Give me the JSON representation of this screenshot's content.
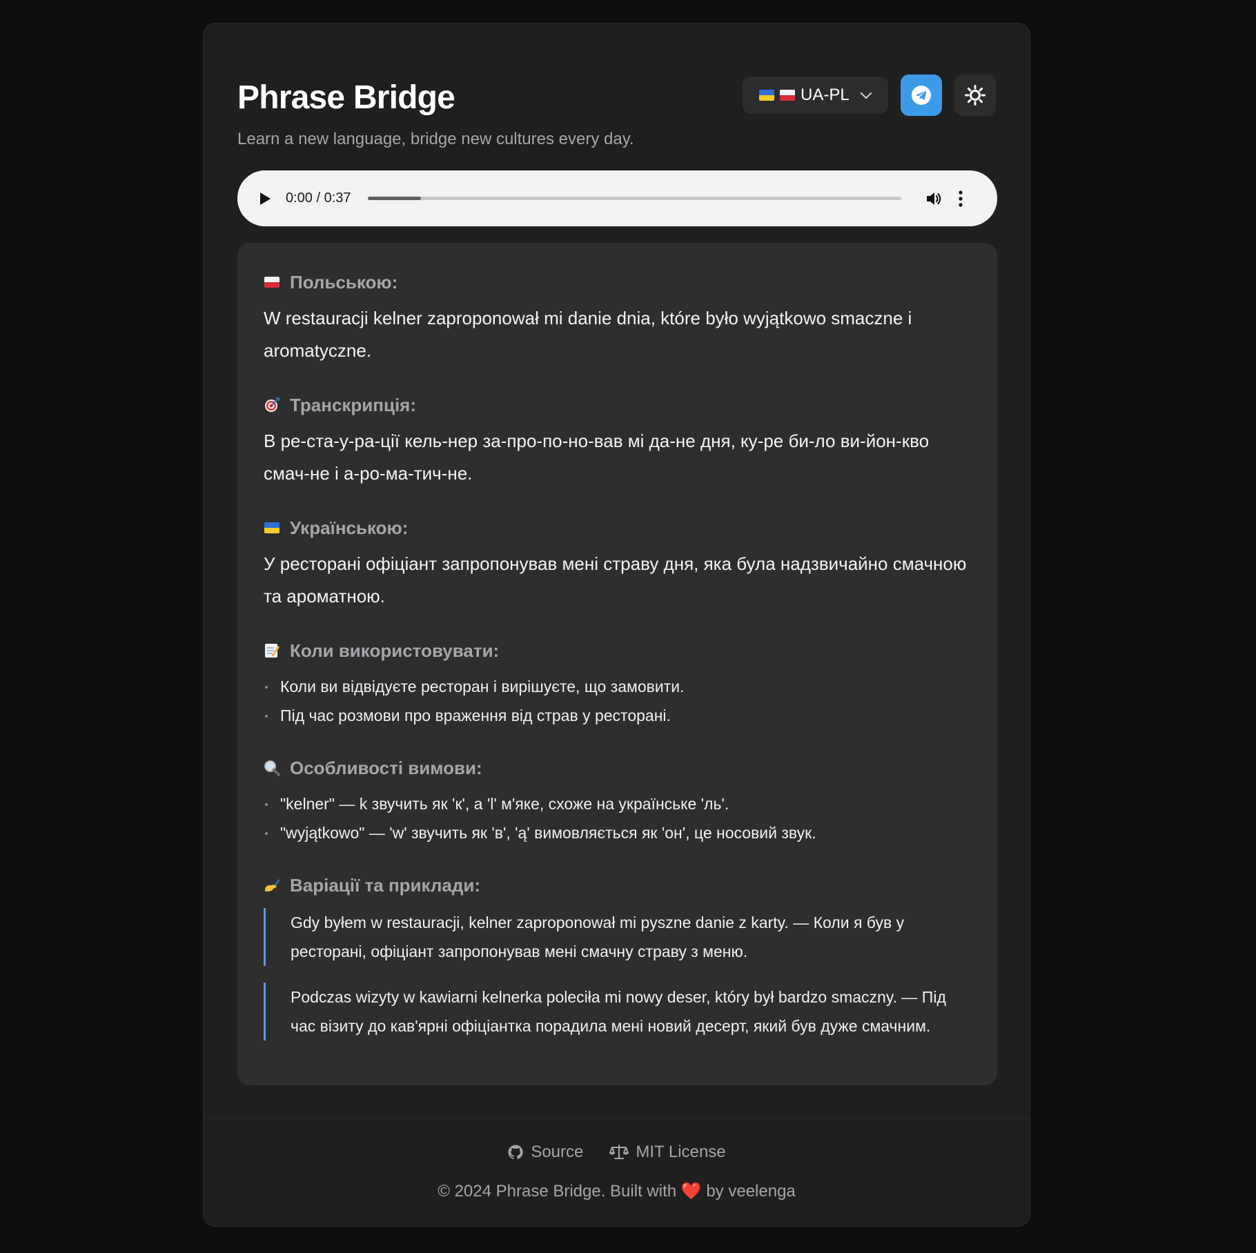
{
  "header": {
    "title": "Phrase Bridge",
    "subtitle": "Learn a new language, bridge new cultures every day.",
    "language_select": {
      "selected": "UA-PL",
      "flags": [
        "ukraine-flag",
        "poland-flag"
      ]
    },
    "telegram_icon": "telegram-icon",
    "theme_icon": "sun-icon"
  },
  "audio": {
    "time": "0:00 / 0:37",
    "progress": 0.1
  },
  "sections": {
    "polish": {
      "icon": "poland-flag",
      "title": "Польською:",
      "text": "W restauracji kelner zaproponował mi danie dnia, które było wyjątkowo smaczne i aromatyczne."
    },
    "transcription": {
      "icon": "target-icon",
      "title": "Транскрипція:",
      "text": "В ре-ста-у-ра-ції кель-нер за-про-по-но-вав мі да-не дня, ку-ре би-ло ви-йон-кво смач-не і а-ро-ма-тич-не."
    },
    "ukrainian": {
      "icon": "ukraine-flag",
      "title": "Українською:",
      "text": "У ресторані офіціант запропонував мені страву дня, яка була надзвичайно смачною та ароматною."
    },
    "usage": {
      "icon": "memo-icon",
      "title": "Коли використовувати:",
      "items": [
        "Коли ви відвідуєте ресторан і вирішуєте, що замовити.",
        "Під час розмови про враження від страв у ресторані."
      ]
    },
    "pronunciation": {
      "icon": "magnifier-icon",
      "title": "Особливості вимови:",
      "items": [
        "\"kelner\" — k звучить як 'к', а 'l' м'яке, схоже на українське 'ль'.",
        "\"wyjątkowo\" — 'w' звучить як 'в', 'ą' вимовляється як 'он', це носовий звук."
      ]
    },
    "variations": {
      "icon": "writing-hand-icon",
      "title": "Варіації та приклади:",
      "items": [
        "Gdy byłem w restauracji, kelner zaproponował mi pyszne danie z karty. — Коли я був у ресторані, офіціант запропонував мені смачну страву з меню.",
        "Podczas wizyty w kawiarni kelnerka poleciła mi nowy deser, który był bardzo smaczny. — Під час візиту до кав'ярні офіціантка порадила мені новий десерт, який був дуже смачним."
      ]
    }
  },
  "footer": {
    "source_label": "Source",
    "license_label": "MIT License",
    "copyright_prefix": "© 2024 Phrase Bridge. Built with",
    "heart": "❤️",
    "copyright_suffix": "by veelenga"
  },
  "colors": {
    "page_bg": "#0e0e0f",
    "card_bg": "#1f1f20",
    "content_bg": "#2e2e2f",
    "telegram": "#3d9ae8",
    "quote_border": "#5b9ce8"
  }
}
